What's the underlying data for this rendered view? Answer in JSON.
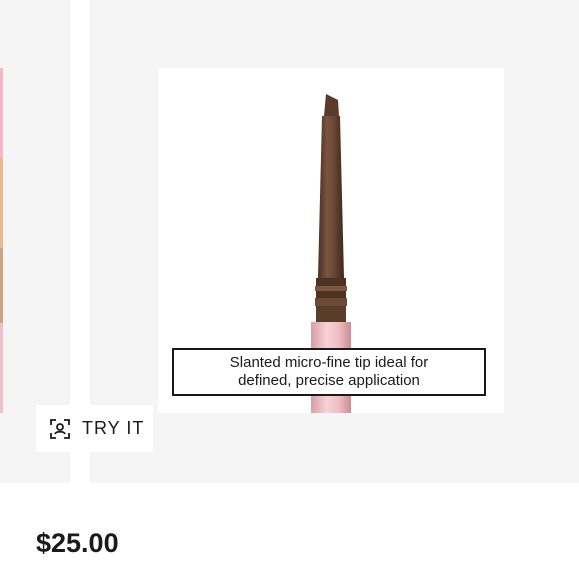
{
  "gallery": {
    "caption_line1": "Slanted micro-fine tip ideal for",
    "caption_line2": "defined, precise application",
    "try_it_label": "TRY IT",
    "swatches": [
      "#f2b8c6",
      "#e8b994",
      "#c9a488",
      "#f0bfcb"
    ]
  },
  "product": {
    "price": "$25.00"
  },
  "icons": {
    "try_it_icon": "face-scan-icon"
  },
  "colors": {
    "pencil_brown": "#6e4a35",
    "pencil_pink": "#f0c3c8",
    "text": "#1a1a1a",
    "slide_bg": "#f5f5f5"
  }
}
